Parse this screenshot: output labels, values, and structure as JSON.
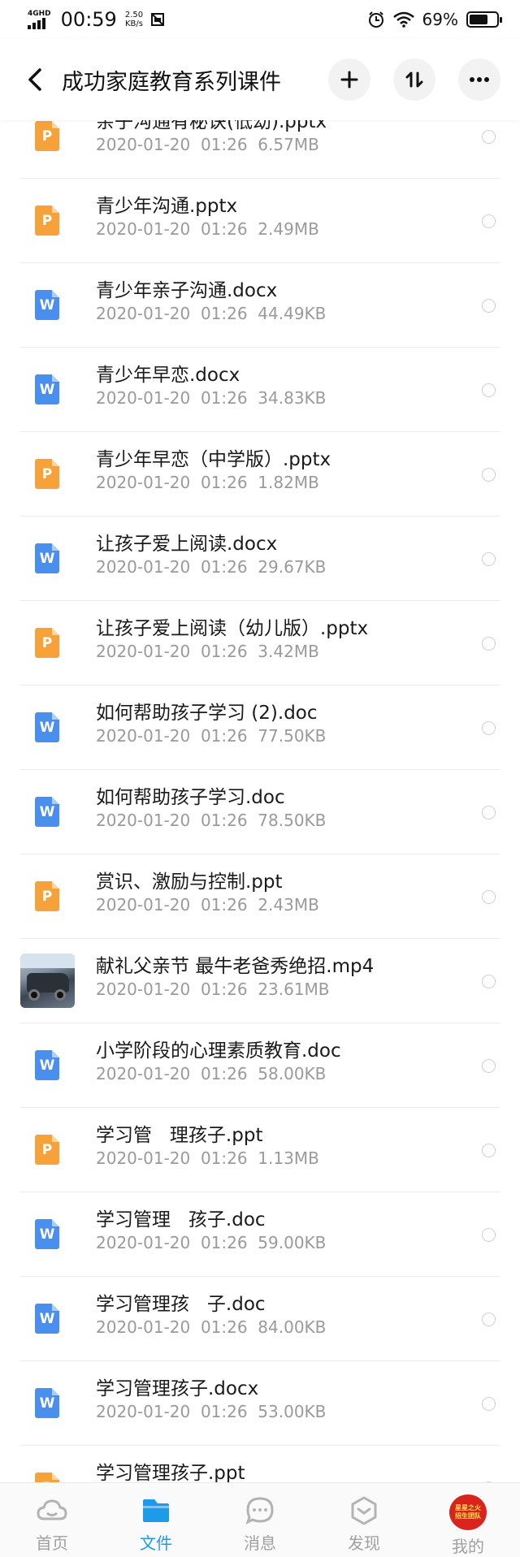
{
  "status_bar": {
    "network": "4GHD",
    "time": "00:59",
    "speed_value": "2.50",
    "speed_unit": "KB/s",
    "battery_percent": "69%",
    "battery_level": 0.69
  },
  "header": {
    "title": "成功家庭教育系列课件"
  },
  "files": [
    {
      "name": "亲子沟通有秘诀(低幼).pptx",
      "meta": "2020-01-20  01:26  6.57MB",
      "type": "ppt",
      "icon": "P"
    },
    {
      "name": "青少年沟通.pptx",
      "meta": "2020-01-20  01:26  2.49MB",
      "type": "ppt",
      "icon": "P"
    },
    {
      "name": "青少年亲子沟通.docx",
      "meta": "2020-01-20  01:26  44.49KB",
      "type": "doc",
      "icon": "W"
    },
    {
      "name": "青少年早恋.docx",
      "meta": "2020-01-20  01:26  34.83KB",
      "type": "doc",
      "icon": "W"
    },
    {
      "name": "青少年早恋（中学版）.pptx",
      "meta": "2020-01-20  01:26  1.82MB",
      "type": "ppt",
      "icon": "P"
    },
    {
      "name": "让孩子爱上阅读.docx",
      "meta": "2020-01-20  01:26  29.67KB",
      "type": "doc",
      "icon": "W"
    },
    {
      "name": "让孩子爱上阅读（幼儿版）.pptx",
      "meta": "2020-01-20  01:26  3.42MB",
      "type": "ppt",
      "icon": "P"
    },
    {
      "name": "如何帮助孩子学习 (2).doc",
      "meta": "2020-01-20  01:26  77.50KB",
      "type": "doc",
      "icon": "W"
    },
    {
      "name": "如何帮助孩子学习.doc",
      "meta": "2020-01-20  01:26  78.50KB",
      "type": "doc",
      "icon": "W"
    },
    {
      "name": "赏识、激励与控制.ppt",
      "meta": "2020-01-20  01:26  2.43MB",
      "type": "ppt",
      "icon": "P"
    },
    {
      "name": "献礼父亲节 最牛老爸秀绝招.mp4",
      "meta": "2020-01-20  01:26  23.61MB",
      "type": "video",
      "icon": ""
    },
    {
      "name": "小学阶段的心理素质教育.doc",
      "meta": "2020-01-20  01:26  58.00KB",
      "type": "doc",
      "icon": "W"
    },
    {
      "name": "学习管   理孩子.ppt",
      "meta": "2020-01-20  01:26  1.13MB",
      "type": "ppt",
      "icon": "P"
    },
    {
      "name": "学习管理   孩子.doc",
      "meta": "2020-01-20  01:26  59.00KB",
      "type": "doc",
      "icon": "W"
    },
    {
      "name": "学习管理孩   子.doc",
      "meta": "2020-01-20  01:26  84.00KB",
      "type": "doc",
      "icon": "W"
    },
    {
      "name": "学习管理孩子.docx",
      "meta": "2020-01-20  01:26  53.00KB",
      "type": "doc",
      "icon": "W"
    },
    {
      "name": "学习管理孩子.ppt",
      "meta": "",
      "type": "ppt",
      "icon": "P"
    }
  ],
  "bottom_nav": [
    {
      "label": "首页",
      "icon": "cloud-icon",
      "active": false
    },
    {
      "label": "文件",
      "icon": "folder-icon",
      "active": true
    },
    {
      "label": "消息",
      "icon": "chat-icon",
      "active": false
    },
    {
      "label": "发现",
      "icon": "discover-icon",
      "active": false
    },
    {
      "label": "我的",
      "icon": "avatar",
      "active": false
    }
  ],
  "avatar_text": [
    "星星之火",
    "招生团队"
  ],
  "colors": {
    "ppt": "#f6a13a",
    "doc": "#4a8ef0",
    "active": "#1e9be8",
    "avatar": "#d8241c"
  }
}
